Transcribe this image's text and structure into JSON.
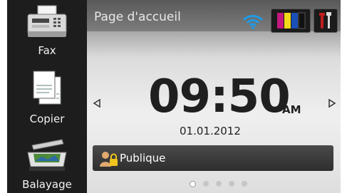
{
  "sidebar": {
    "items": [
      {
        "label": "Fax",
        "icon": "fax-icon"
      },
      {
        "label": "Copier",
        "icon": "copier-icon"
      },
      {
        "label": "Balayage",
        "icon": "scanner-icon"
      }
    ]
  },
  "header": {
    "title": "Page d'accueil",
    "icons": [
      "wifi-icon",
      "ink-icon",
      "tools-icon"
    ]
  },
  "clock": {
    "time": "09:50",
    "ampm": "AM",
    "date": "01.01.2012"
  },
  "secure_function": {
    "label": "Publique",
    "icon": "user-lock-icon"
  },
  "pagination": {
    "total": 5,
    "active": 1
  },
  "colors": {
    "wifi": "#1e9be6",
    "ink_magenta": "#c2187f",
    "ink_yellow": "#f2d81a",
    "ink_cyan": "#1a4fb8",
    "ink_black": "#111111",
    "tools_red": "#c21d1d"
  }
}
